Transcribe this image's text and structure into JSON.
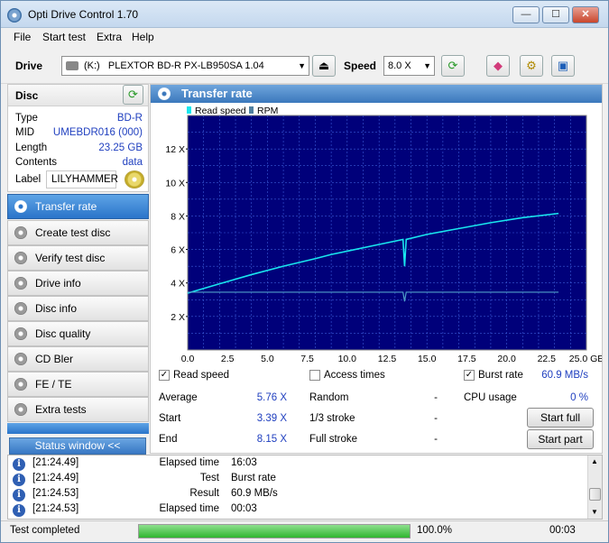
{
  "window": {
    "title": "Opti Drive Control 1.70",
    "btn_min": "—",
    "btn_max": "☐",
    "btn_close": "✕"
  },
  "menu": [
    "File",
    "Start test",
    "Extra",
    "Help"
  ],
  "toolbar": {
    "drive_label": "Drive",
    "drive_letter": "(K:)",
    "drive_name": "PLEXTOR BD-R  PX-LB950SA 1.04",
    "speed_label": "Speed",
    "speed_value": "8.0 X"
  },
  "disc": {
    "title": "Disc",
    "rows": [
      {
        "label": "Type",
        "value": "BD-R"
      },
      {
        "label": "MID",
        "value": "UMEBDR016 (000)"
      },
      {
        "label": "Length",
        "value": "23.25 GB"
      },
      {
        "label": "Contents",
        "value": "data"
      }
    ],
    "label_label": "Label",
    "label_value": "LILYHAMMER"
  },
  "nav": [
    "Transfer rate",
    "Create test disc",
    "Verify test disc",
    "Drive info",
    "Disc info",
    "Disc quality",
    "CD Bler",
    "FE / TE",
    "Extra tests"
  ],
  "status_window_label": "Status window <<",
  "main_title": "Transfer rate",
  "chart_data": {
    "type": "line",
    "legend": [
      "Read speed",
      "RPM"
    ],
    "xlabel": "",
    "ylabel": "",
    "xlim": [
      0,
      25
    ],
    "ylim": [
      0,
      14
    ],
    "x_ticks": [
      "0.0",
      "2.5",
      "5.0",
      "7.5",
      "10.0",
      "12.5",
      "15.0",
      "17.5",
      "20.0",
      "22.5",
      "25.0 GB"
    ],
    "y_ticks": [
      "2 X",
      "4 X",
      "6 X",
      "8 X",
      "10 X",
      "12 X"
    ],
    "series": [
      {
        "name": "Read speed",
        "x": [
          0,
          2,
          4,
          6,
          8,
          9,
          10,
          12,
          13.5,
          13.6,
          13.7,
          15,
          17,
          19,
          21,
          23.25
        ],
        "y": [
          3.39,
          3.95,
          4.5,
          5.0,
          5.45,
          5.7,
          5.9,
          6.3,
          6.6,
          5.0,
          6.6,
          6.9,
          7.25,
          7.6,
          7.9,
          8.15
        ]
      },
      {
        "name": "RPM",
        "x": [
          0,
          5,
          10,
          13.5,
          13.6,
          13.7,
          18,
          23.25
        ],
        "y": [
          3.45,
          3.45,
          3.45,
          3.45,
          2.9,
          3.45,
          3.45,
          3.45
        ]
      }
    ]
  },
  "stats": {
    "read_speed_label": "Read speed",
    "access_times_label": "Access times",
    "burst_rate_label": "Burst rate",
    "burst_rate_value": "60.9 MB/s",
    "average_label": "Average",
    "average_value": "5.76 X",
    "start_label": "Start",
    "start_value": "3.39 X",
    "end_label": "End",
    "end_value": "8.15 X",
    "random_label": "Random",
    "random_value": "-",
    "third_label": "1/3 stroke",
    "third_value": "-",
    "full_label": "Full stroke",
    "full_value": "-",
    "cpu_label": "CPU usage",
    "cpu_value": "0 %",
    "start_full": "Start full",
    "start_part": "Start part"
  },
  "log": [
    {
      "time": "[21:24.49]",
      "key": "Elapsed time",
      "value": "16:03"
    },
    {
      "time": "[21:24.49]",
      "key": "Test",
      "value": "Burst rate"
    },
    {
      "time": "[21:24.53]",
      "key": "Result",
      "value": "60.9 MB/s"
    },
    {
      "time": "[21:24.53]",
      "key": "Elapsed time",
      "value": "00:03"
    }
  ],
  "status": {
    "text": "Test completed",
    "progress": 100,
    "progress_text": "100.0%",
    "elapsed": "00:03"
  },
  "colors": {
    "plot_bg": "#00007a",
    "grid": "#3b5bd8",
    "read_line": "#19e6ee",
    "rpm_line": "#4fa0c8"
  }
}
